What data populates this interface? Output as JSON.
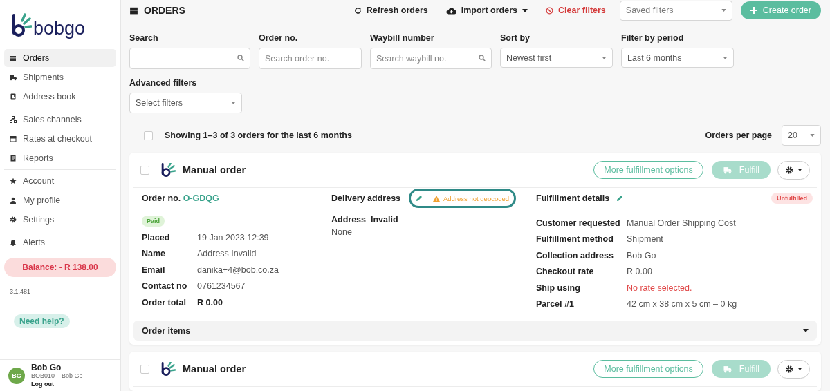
{
  "sidebar": {
    "logo": "bobgo",
    "nav_groups": [
      [
        {
          "label": "Orders",
          "selected": true
        },
        {
          "label": "Shipments",
          "selected": false
        },
        {
          "label": "Address book",
          "selected": false
        }
      ],
      [
        {
          "label": "Sales channels",
          "selected": false
        },
        {
          "label": "Rates at checkout",
          "selected": false
        },
        {
          "label": "Reports",
          "selected": false
        }
      ],
      [
        {
          "label": "Account",
          "selected": false
        },
        {
          "label": "My profile",
          "selected": false
        },
        {
          "label": "Settings",
          "selected": false
        }
      ],
      [
        {
          "label": "Alerts",
          "selected": false
        }
      ]
    ],
    "balance": "Balance: - R 138.00",
    "version": "3.1.481",
    "help": "Need help?",
    "user": {
      "initials": "BG",
      "name": "Bob Go",
      "account": "BOB010 – Bob Go",
      "logout": "Log out"
    }
  },
  "header": {
    "title": "ORDERS",
    "actions": [
      {
        "kind": "refresh",
        "label": "Refresh orders"
      },
      {
        "kind": "import",
        "label": "Import orders"
      },
      {
        "kind": "clear",
        "label": "Clear filters"
      }
    ],
    "saved_filters": {
      "placeholder": "Saved filters"
    },
    "create": "Create order"
  },
  "filters": [
    {
      "label": "Search",
      "kind": "search"
    },
    {
      "label": "Order no.",
      "kind": "text",
      "placeholder": "Search order no."
    },
    {
      "label": "Waybill number",
      "kind": "search",
      "placeholder": "Search waybill no."
    },
    {
      "label": "Sort by",
      "kind": "select",
      "value": "Newest first"
    },
    {
      "label": "Filter by period",
      "kind": "select",
      "value": "Last 6 months"
    }
  ],
  "advanced": {
    "label": "Advanced filters",
    "placeholder": "Select filters"
  },
  "summary": {
    "checked": false,
    "text": "Showing 1–3 of 3 orders for the last 6 months",
    "per_page_label": "Orders per page",
    "per_page": "20"
  },
  "orders": [
    {
      "title": "Manual order",
      "checked": false,
      "more": "More fulfillment options",
      "fulfill": "Fulfill",
      "order_no_label": "Order no.",
      "order_no": "O-GDQG",
      "payment": "Paid",
      "details": [
        {
          "label": "Placed",
          "value": "19 Jan 2023 12:39",
          "kind": "plain"
        },
        {
          "label": "Name",
          "value": "Address Invalid",
          "kind": "plain"
        },
        {
          "label": "Email",
          "value": "danika+4@bob.co.za",
          "kind": "plain"
        },
        {
          "label": "Contact no",
          "value": "0761234567",
          "kind": "plain"
        },
        {
          "label": "Order total",
          "value": "R 0.00",
          "kind": "strong"
        }
      ],
      "delivery": {
        "title": "Delivery address",
        "warning": "Address not geocoded",
        "name": "Address  Invalid",
        "line": "None"
      },
      "fulfillment": {
        "title": "Fulfillment details",
        "status": "Unfulfilled",
        "rows": [
          {
            "label": "Customer requested",
            "value": "Manual Order Shipping Cost",
            "kind": "plain"
          },
          {
            "label": "Fulfillment method",
            "value": "Shipment",
            "kind": "plain"
          },
          {
            "label": "Collection address",
            "value": "Bob Go",
            "kind": "plain"
          },
          {
            "label": "Checkout rate",
            "value": "R 0.00",
            "kind": "plain"
          },
          {
            "label": "Ship using",
            "value": "No rate selected.",
            "kind": "error"
          },
          {
            "label": "Parcel #1",
            "value": "42 cm x 38 cm x 5 cm – 0 kg",
            "kind": "plain"
          }
        ]
      },
      "items": "Order items"
    },
    {
      "title": "Manual order",
      "checked": false,
      "more": "More fulfillment options",
      "fulfill": "Fulfill"
    }
  ]
}
